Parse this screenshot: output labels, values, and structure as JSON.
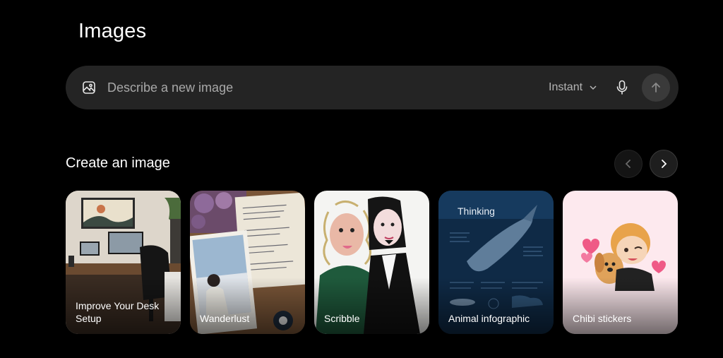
{
  "page": {
    "title": "Images"
  },
  "composer": {
    "placeholder": "Describe a new image",
    "mode_label": "Instant",
    "icons": {
      "image": "image-icon",
      "mode": "chevron-down-icon",
      "mic": "microphone-icon",
      "send": "arrow-up-icon"
    }
  },
  "gallery": {
    "title": "Create an image",
    "icons": {
      "prev": "chevron-left-icon",
      "next": "chevron-right-icon"
    },
    "cards": [
      {
        "label": "Improve Your Desk Setup"
      },
      {
        "label": "Wanderlust"
      },
      {
        "label": "Scribble"
      },
      {
        "label": "Animal infographic",
        "overlay_text": "Thinking"
      },
      {
        "label": "Chibi stickers"
      }
    ]
  },
  "colors": {
    "background": "#000000",
    "composer": "#242424",
    "send_button": "#3a3a3a"
  }
}
